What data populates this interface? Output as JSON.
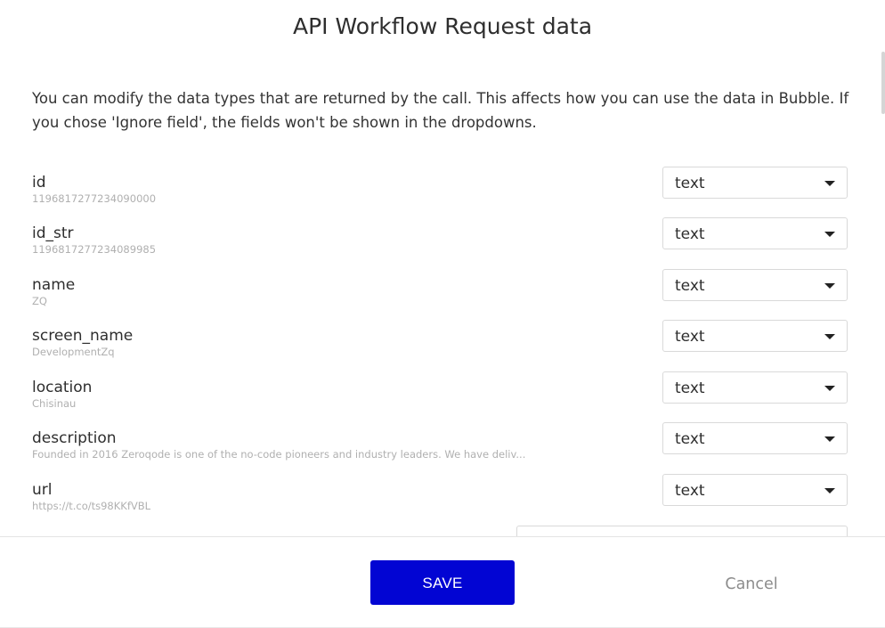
{
  "dialog": {
    "title": "API Workflow Request data",
    "intro": "You can modify the data types that are returned by the call. This affects how you can use the data in Bubble. If you chose 'Ignore field', the fields won't be shown in the dropdowns."
  },
  "fields": [
    {
      "name": "id",
      "sample": "1196817277234090000",
      "type": "text"
    },
    {
      "name": "id_str",
      "sample": "1196817277234089985",
      "type": "text"
    },
    {
      "name": "name",
      "sample": "ZQ",
      "type": "text"
    },
    {
      "name": "screen_name",
      "sample": "DevelopmentZq",
      "type": "text"
    },
    {
      "name": "location",
      "sample": "Chisinau",
      "type": "text"
    },
    {
      "name": "description",
      "sample": "Founded in 2016 Zeroqode is one of the no-code pioneers and industry leaders. We have deliv...",
      "type": "text"
    },
    {
      "name": "url",
      "sample": "https://t.co/ts98KKfVBL",
      "type": "text"
    }
  ],
  "footer": {
    "save_label": "SAVE",
    "cancel_label": "Cancel"
  },
  "colors": {
    "primary": "#0205d3",
    "muted_text": "#8c8c8c",
    "sample_text": "#b0b0b0",
    "border": "#d9d9d9"
  },
  "icons": {
    "select_caret": "caret-down-icon"
  }
}
